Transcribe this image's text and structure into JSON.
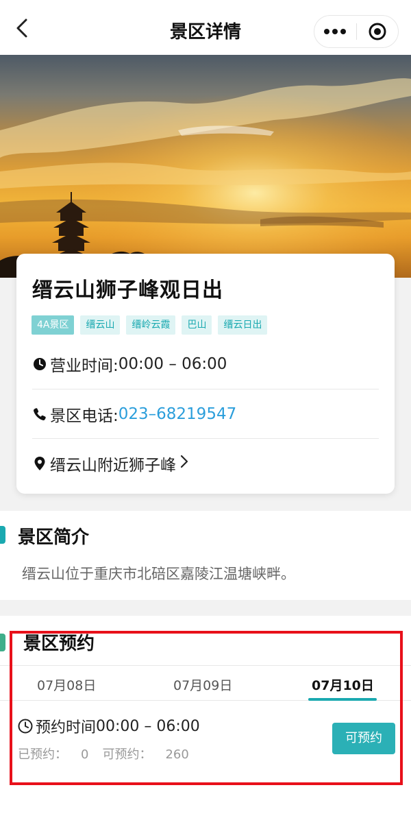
{
  "header": {
    "title": "景区详情",
    "back_icon": "chevron-left-icon",
    "more_icon": "more-dots-icon",
    "target_icon": "target-icon"
  },
  "hero": {
    "image": "sunset-pagoda-photo"
  },
  "scenic": {
    "name": "缙云山狮子峰观日出",
    "tags": [
      "4A景区",
      "缙云山",
      "缙岭云霞",
      "巴山",
      "缙云日出"
    ],
    "hours_label": "营业时间: ",
    "hours_value": "00:00 – 06:00",
    "phone_label": "景区电话: ",
    "phone_value": "023–68219547",
    "address": "缙云山附近狮子峰"
  },
  "intro": {
    "title": "景区简介",
    "text": "缙云山位于重庆市北碚区嘉陵江温塘峡畔。"
  },
  "reservation": {
    "title": "景区预约",
    "dates": [
      "07月08日",
      "07月09日",
      "07月10日"
    ],
    "selected_date": "07月10日",
    "slot_label": "预约时间 ",
    "slot_value": "00:00 – 06:00",
    "booked_label": "已预约：",
    "booked_value": "0",
    "available_label": "可预约：",
    "available_value": "260",
    "book_button": "可预约"
  },
  "colors": {
    "accent": "#2bb0b6",
    "tag_bg": "#dff4f4",
    "phone": "#2b9edb",
    "highlight": "#e8101a"
  }
}
